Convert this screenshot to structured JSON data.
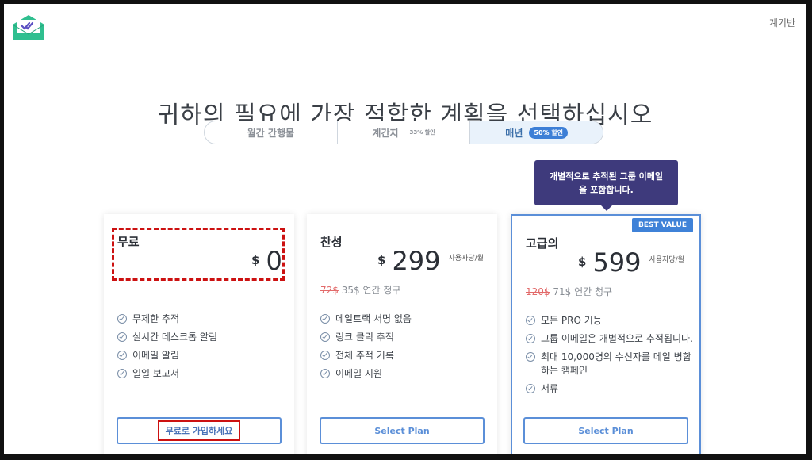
{
  "header": {
    "dashboard_label": "계기반"
  },
  "headline": "귀하의 필요에 가장 적합한 계획을 선택하십시오",
  "billing_tabs": [
    {
      "label": "월간 간행물",
      "note": "",
      "active": false
    },
    {
      "label": "계간지",
      "note": "33% 할인",
      "active": false
    },
    {
      "label": "매년",
      "note": "50% 할인",
      "active": true
    }
  ],
  "tooltip": "개별적으로 추적된 그룹 이메일을 포함합니다.",
  "plans": [
    {
      "name": "무료",
      "currency": "$",
      "price": "0",
      "unit": "",
      "annual_old": "",
      "annual_new": "",
      "features": [
        "무제한 추적",
        "실시간 데스크톱 알림",
        "이메일 알림",
        "일일 보고서"
      ],
      "button": "무료로 가입하세요"
    },
    {
      "name": "찬성",
      "currency": "$",
      "price": "299",
      "unit": "사용자당/월",
      "annual_old": "72$",
      "annual_new": "35$ 연간 청구",
      "features": [
        "메일트랙 서명 없음",
        "링크 클릭 추적",
        "전체 추적 기록",
        "이메일 지원"
      ],
      "button": "Select Plan"
    },
    {
      "name": "고급의",
      "badge": "BEST VALUE",
      "currency": "$",
      "price": "599",
      "unit": "사용자당/월",
      "annual_old": "120$",
      "annual_new": "71$ 연간 청구",
      "features": [
        "모든 PRO 기능",
        "그룹 이메일은 개별적으로 추적됩니다.",
        "최대 10,000명의 수신자를 메일 병합하는 캠페인",
        "서류"
      ],
      "button": "Select Plan"
    }
  ],
  "colors": {
    "accent": "#3f82d8",
    "tooltip_bg": "#3e3a7c",
    "logo": "#2fbf8f",
    "highlight": "#cc1111"
  }
}
